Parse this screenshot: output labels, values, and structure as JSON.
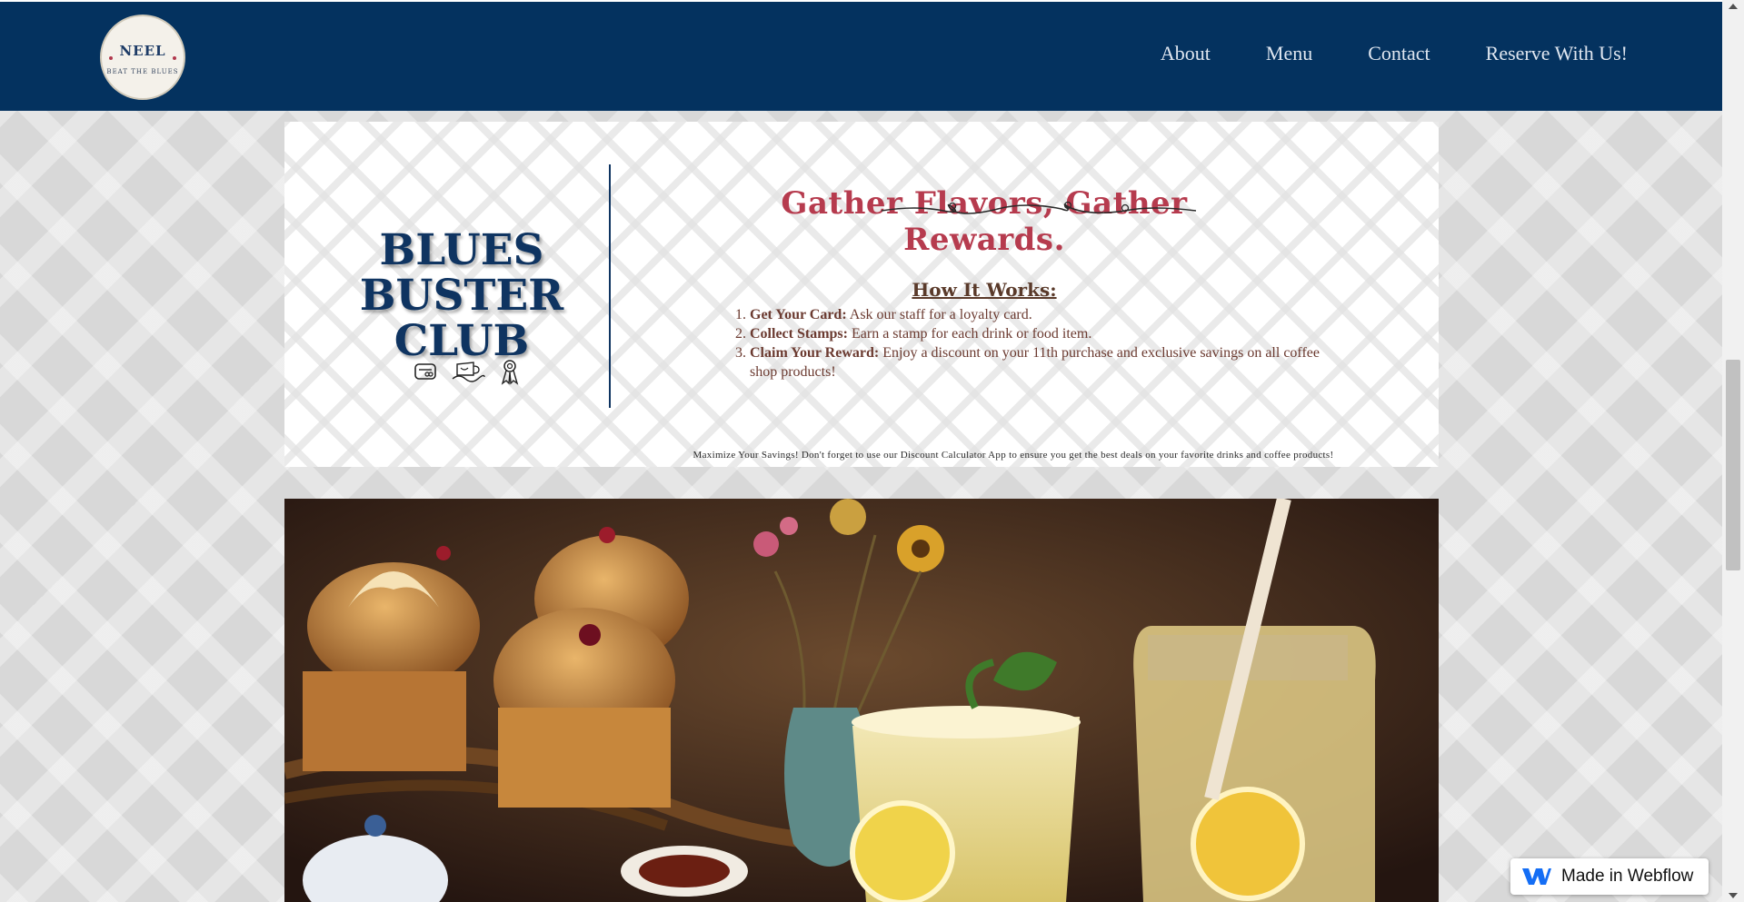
{
  "header": {
    "logo": {
      "top_text": "NEEL",
      "bottom_text": "BEAT THE BLUES"
    },
    "nav": [
      {
        "label": "About"
      },
      {
        "label": "Menu"
      },
      {
        "label": "Contact"
      },
      {
        "label": "Reserve With Us!"
      }
    ]
  },
  "loyalty": {
    "club_title": "BLUES BUSTER CLUB",
    "icons": [
      "loyalty-card-icon",
      "coffee-stamp-icon",
      "reward-ribbon-icon"
    ],
    "headline": "Gather Flavors, Gather Rewards.",
    "how_title": "How It Works:",
    "steps": [
      {
        "label": "Get Your Card:",
        "text": " Ask our staff for a loyalty card."
      },
      {
        "label": "Collect Stamps:",
        "text": " Earn a stamp for each drink or food item."
      },
      {
        "label": "Claim Your Reward:",
        "text": " Enjoy a discount on your 11th purchase and exclusive savings on all coffee shop products!"
      }
    ],
    "savings_note": "Maximize Your Savings! Don't forget to use our Discount Calculator App to ensure you get the best deals on your favorite drinks and coffee products!"
  },
  "photo": {
    "subject": "cupcakes, dried flowers, lemonade glass with mint, lemon jar, tea cup"
  },
  "badge": {
    "label": "Made in Webflow"
  },
  "colors": {
    "navbar": "#04325f",
    "club_title": "#0f3461",
    "headline": "#b63b4e",
    "step_text": "#6b3a30"
  }
}
